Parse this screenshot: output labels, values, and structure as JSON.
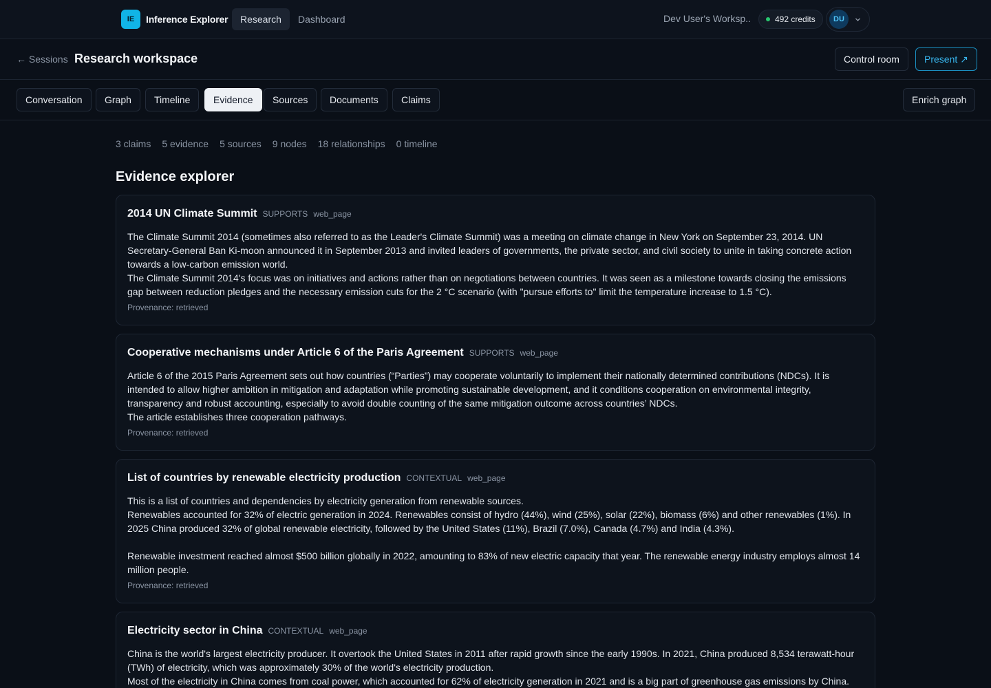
{
  "topnav": {
    "logo_text": "IE",
    "brand": "Inference Explorer",
    "links": [
      "Research",
      "Dashboard"
    ],
    "workspace": "Dev User's Worksp...",
    "credits": "492 credits",
    "avatar": "DU",
    "colors": {
      "accent": "#11b4e6",
      "credits_dot": "#28c76f"
    }
  },
  "header": {
    "back": "← Sessions",
    "title": "Research workspace",
    "control_room": "Control room",
    "present": "Present ↗"
  },
  "tabs": [
    "Conversation",
    "Graph",
    "Timeline",
    "Evidence",
    "Sources",
    "Documents",
    "Claims"
  ],
  "active_tab": "Evidence",
  "enrich_graph": "Enrich graph",
  "stats": [
    "3 claims",
    "5 evidence",
    "5 sources",
    "9 nodes",
    "18 relationships",
    "0 timeline"
  ],
  "section_title": "Evidence explorer",
  "evidence": [
    {
      "title": "2014 UN Climate Summit",
      "stance": "SUPPORTS",
      "type": "web_page",
      "body": "The Climate Summit 2014 (sometimes also referred to as the Leader's Climate Summit) was a meeting on climate change in New York on September 23, 2014. UN Secretary-General Ban Ki-moon announced it in September 2013 and invited leaders of governments, the private sector, and civil society to unite in taking concrete action towards a low-carbon emission world.\nThe Climate Summit 2014's focus was on initiatives and actions rather than on negotiations between countries. It was seen as a milestone towards closing the emissions gap between reduction pledges and the necessary emission cuts for the 2 °C scenario (with \"pursue efforts to\" limit the temperature increase to 1.5 °C).",
      "provenance": "Provenance: retrieved"
    },
    {
      "title": "Cooperative mechanisms under Article 6 of the Paris Agreement",
      "stance": "SUPPORTS",
      "type": "web_page",
      "body": "Article 6 of the 2015 Paris Agreement sets out how countries (“Parties”) may cooperate voluntarily to implement their nationally determined contributions (NDCs). It is intended to allow higher ambition in mitigation and adaptation while promoting sustainable development, and it conditions cooperation on environmental integrity, transparency and robust accounting, especially to avoid double counting of the same mitigation outcome across countries’ NDCs.\nThe article establishes three cooperation pathways.",
      "provenance": "Provenance: retrieved"
    },
    {
      "title": "List of countries by renewable electricity production",
      "stance": "CONTEXTUAL",
      "type": "web_page",
      "body": "This is a list of countries and dependencies by electricity generation from renewable sources.\nRenewables accounted for 32% of electric generation in 2024. Renewables consist of hydro (44%), wind (25%), solar (22%), biomass (6%) and other renewables (1%). In 2025 China produced 32% of global renewable electricity, followed by the United States (11%), Brazil (7.0%), Canada (4.7%) and India (4.3%).\n\nRenewable investment reached almost $500 billion globally in 2022, amounting to 83% of new electric capacity that year. The renewable energy industry employs almost 14 million people.",
      "provenance": "Provenance: retrieved"
    },
    {
      "title": "Electricity sector in China",
      "stance": "CONTEXTUAL",
      "type": "web_page",
      "body": "China is the world's largest electricity producer. It overtook the United States in 2011 after rapid growth since the early 1990s. In 2021, China produced 8,534 terawatt-hour (TWh) of electricity, which was approximately 30% of the world's electricity production.\nMost of the electricity in China comes from coal power, which accounted for 62% of electricity generation in 2021 and is a big part of greenhouse gas emissions by China.",
      "provenance": ""
    }
  ]
}
